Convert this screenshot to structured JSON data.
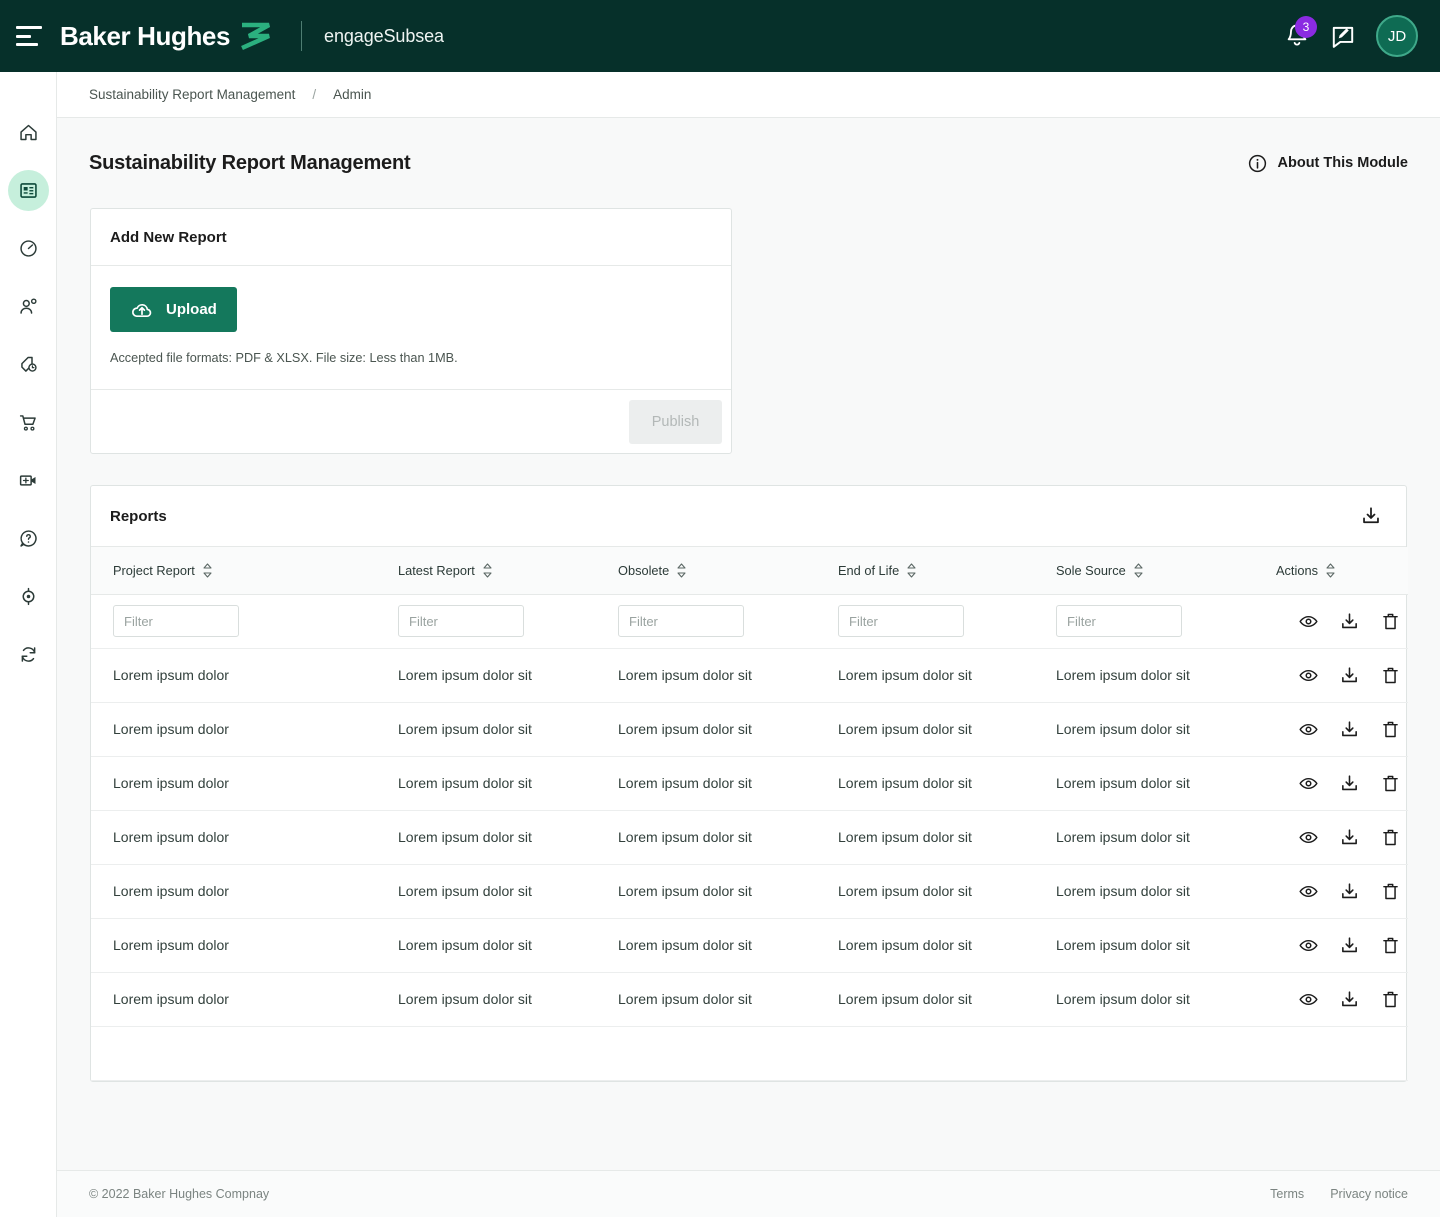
{
  "topbar": {
    "menu_icon": "hamburger-icon",
    "brand": "Baker Hughes",
    "brand_mark_icon": "baker-hughes-logo-icon",
    "product": "engageSubsea",
    "notification_icon": "bell-icon",
    "notification_count": "3",
    "message_icon": "message-edit-icon",
    "avatar_initials": "JD",
    "bg_color": "#06302A",
    "badge_color": "#8A2BE2"
  },
  "sidebar": {
    "items": [
      {
        "name": "home",
        "icon": "home-icon",
        "active": false
      },
      {
        "name": "reports",
        "icon": "report-card-icon",
        "active": true
      },
      {
        "name": "performance",
        "icon": "gauge-icon",
        "active": false
      },
      {
        "name": "users",
        "icon": "user-settings-icon",
        "active": false
      },
      {
        "name": "tags",
        "icon": "tag-clock-icon",
        "active": false
      },
      {
        "name": "orders",
        "icon": "shopping-cart-icon",
        "active": false
      },
      {
        "name": "video",
        "icon": "video-add-icon",
        "active": false
      },
      {
        "name": "help",
        "icon": "question-mark-icon",
        "active": false
      },
      {
        "name": "tracking",
        "icon": "location-pin-icon",
        "active": false
      },
      {
        "name": "sync",
        "icon": "refresh-icon",
        "active": false
      }
    ],
    "active_bg": "#C6EFDC"
  },
  "breadcrumb": {
    "parent": "Sustainability Report Management",
    "separator": "/",
    "current": "Admin"
  },
  "page": {
    "title": "Sustainability Report Management",
    "about_label": "About This Module",
    "about_icon": "info-circle-icon"
  },
  "add_report": {
    "title": "Add New Report",
    "upload_label": "Upload",
    "upload_icon": "cloud-upload-icon",
    "hint": "Accepted file formats: PDF & XLSX. File size: Less than 1MB.",
    "publish_label": "Publish",
    "publish_disabled": true,
    "upload_color": "#14785C"
  },
  "reports": {
    "title": "Reports",
    "download_all_icon": "download-icon",
    "columns": [
      {
        "label": "Project Report",
        "sortable": true
      },
      {
        "label": "Latest Report",
        "sortable": true
      },
      {
        "label": "Obsolete",
        "sortable": true
      },
      {
        "label": "End of Life",
        "sortable": true
      },
      {
        "label": "Sole Source",
        "sortable": true
      },
      {
        "label": "Actions",
        "sortable": true
      }
    ],
    "filter_placeholder": "Filter",
    "row_actions": [
      {
        "name": "view",
        "icon": "eye-icon"
      },
      {
        "name": "download",
        "icon": "download-icon"
      },
      {
        "name": "delete",
        "icon": "trash-icon"
      }
    ],
    "rows": [
      {
        "project_report": "Lorem ipsum dolor",
        "latest_report": "Lorem ipsum dolor sit",
        "obsolete": "Lorem ipsum dolor sit",
        "end_of_life": "Lorem ipsum dolor sit",
        "sole_source": "Lorem ipsum dolor sit"
      },
      {
        "project_report": "Lorem ipsum dolor",
        "latest_report": "Lorem ipsum dolor sit",
        "obsolete": "Lorem ipsum dolor sit",
        "end_of_life": "Lorem ipsum dolor sit",
        "sole_source": "Lorem ipsum dolor sit"
      },
      {
        "project_report": "Lorem ipsum dolor",
        "latest_report": "Lorem ipsum dolor sit",
        "obsolete": "Lorem ipsum dolor sit",
        "end_of_life": "Lorem ipsum dolor sit",
        "sole_source": "Lorem ipsum dolor sit"
      },
      {
        "project_report": "Lorem ipsum dolor",
        "latest_report": "Lorem ipsum dolor sit",
        "obsolete": "Lorem ipsum dolor sit",
        "end_of_life": "Lorem ipsum dolor sit",
        "sole_source": "Lorem ipsum dolor sit"
      },
      {
        "project_report": "Lorem ipsum dolor",
        "latest_report": "Lorem ipsum dolor sit",
        "obsolete": "Lorem ipsum dolor sit",
        "end_of_life": "Lorem ipsum dolor sit",
        "sole_source": "Lorem ipsum dolor sit"
      },
      {
        "project_report": "Lorem ipsum dolor",
        "latest_report": "Lorem ipsum dolor sit",
        "obsolete": "Lorem ipsum dolor sit",
        "end_of_life": "Lorem ipsum dolor sit",
        "sole_source": "Lorem ipsum dolor sit"
      },
      {
        "project_report": "Lorem ipsum dolor",
        "latest_report": "Lorem ipsum dolor sit",
        "obsolete": "Lorem ipsum dolor sit",
        "end_of_life": "Lorem ipsum dolor sit",
        "sole_source": "Lorem ipsum dolor sit"
      }
    ]
  },
  "footer": {
    "copyright": "© 2022 Baker Hughes Compnay",
    "terms": "Terms",
    "privacy": "Privacy notice"
  }
}
